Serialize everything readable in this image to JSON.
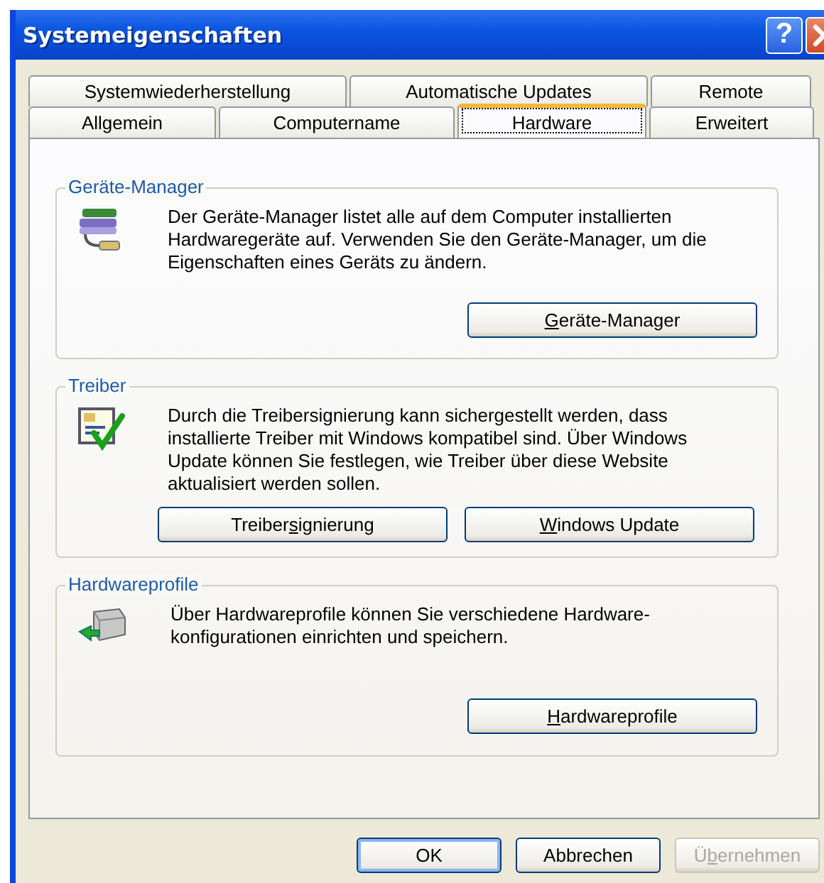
{
  "window": {
    "title": "Systemeigenschaften",
    "help_button": "?"
  },
  "tab_rows": [
    [
      {
        "label": "Systemwiederherstellung",
        "selected": false
      },
      {
        "label": "Automatische Updates",
        "selected": false
      },
      {
        "label": "Remote",
        "selected": false
      }
    ],
    [
      {
        "label": "Allgemein",
        "selected": false
      },
      {
        "label": "Computername",
        "selected": false
      },
      {
        "label": "Hardware",
        "selected": true
      },
      {
        "label": "Erweitert",
        "selected": false
      }
    ]
  ],
  "groups": [
    {
      "title": "Geräte-Manager",
      "kind": "devices",
      "text": "Der Geräte-Manager listet alle auf dem Computer installierten Hardwaregeräte auf. Verwenden Sie den Geräte-Manager, um die Eigenschaften eines Geräts zu ändern.",
      "buttons": [
        [
          {
            "text": "G",
            "underline": true
          },
          {
            "text": "eräte-Manager",
            "underline": false
          }
        ]
      ]
    },
    {
      "title": "Treiber",
      "kind": "driver",
      "text": "Durch die Treibersignierung kann sichergestellt werden, dass installierte Treiber mit Windows kompatibel sind. Über Windows Update können Sie festlegen, wie Treiber über diese Website aktualisiert werden sollen.",
      "buttons": [
        [
          {
            "text": "Treiber",
            "underline": false
          },
          {
            "text": "s",
            "underline": true
          },
          {
            "text": "ignierung",
            "underline": false
          }
        ],
        [
          {
            "text": "W",
            "underline": true
          },
          {
            "text": "indows Update",
            "underline": false
          }
        ]
      ]
    },
    {
      "title": "Hardwareprofile",
      "kind": "profiles",
      "text": "Über Hardwareprofile können Sie verschiedene Hardware-konfigurationen einrichten und speichern.",
      "buttons": [
        [
          {
            "text": "H",
            "underline": true
          },
          {
            "text": "ardwareprofile",
            "underline": false
          }
        ]
      ]
    }
  ],
  "footer_buttons": [
    {
      "parts": [
        {
          "text": "OK",
          "underline": false
        }
      ],
      "disabled": false
    },
    {
      "parts": [
        {
          "text": "Abbrechen",
          "underline": false
        }
      ],
      "disabled": false
    },
    {
      "parts": [
        {
          "text": "Ü",
          "underline": false
        },
        {
          "text": "b",
          "underline": true
        },
        {
          "text": "ernehmen",
          "underline": false
        }
      ],
      "disabled": true
    }
  ]
}
